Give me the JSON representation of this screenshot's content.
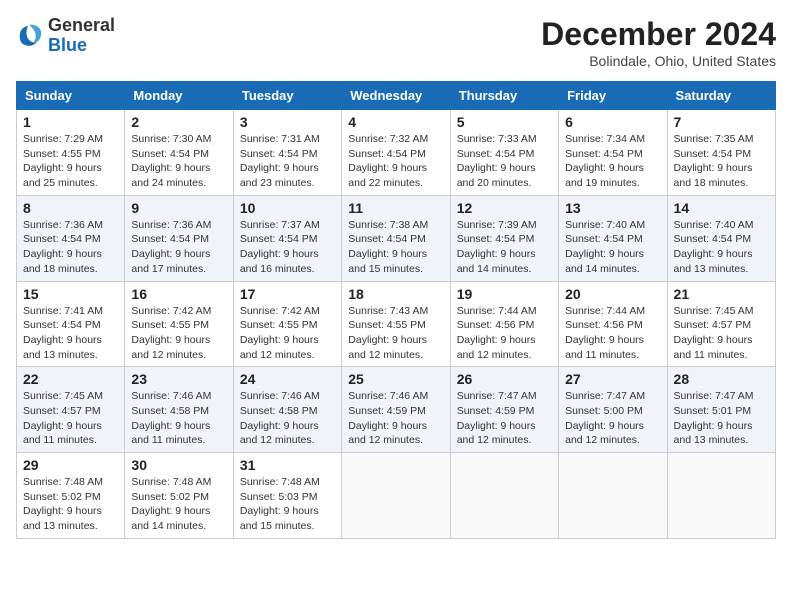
{
  "logo": {
    "line1": "General",
    "line2": "Blue"
  },
  "title": "December 2024",
  "subtitle": "Bolindale, Ohio, United States",
  "weekdays": [
    "Sunday",
    "Monday",
    "Tuesday",
    "Wednesday",
    "Thursday",
    "Friday",
    "Saturday"
  ],
  "weeks": [
    [
      {
        "day": 1,
        "sunrise": "7:29 AM",
        "sunset": "4:55 PM",
        "daylight": "9 hours and 25 minutes."
      },
      {
        "day": 2,
        "sunrise": "7:30 AM",
        "sunset": "4:54 PM",
        "daylight": "9 hours and 24 minutes."
      },
      {
        "day": 3,
        "sunrise": "7:31 AM",
        "sunset": "4:54 PM",
        "daylight": "9 hours and 23 minutes."
      },
      {
        "day": 4,
        "sunrise": "7:32 AM",
        "sunset": "4:54 PM",
        "daylight": "9 hours and 22 minutes."
      },
      {
        "day": 5,
        "sunrise": "7:33 AM",
        "sunset": "4:54 PM",
        "daylight": "9 hours and 20 minutes."
      },
      {
        "day": 6,
        "sunrise": "7:34 AM",
        "sunset": "4:54 PM",
        "daylight": "9 hours and 19 minutes."
      },
      {
        "day": 7,
        "sunrise": "7:35 AM",
        "sunset": "4:54 PM",
        "daylight": "9 hours and 18 minutes."
      }
    ],
    [
      {
        "day": 8,
        "sunrise": "7:36 AM",
        "sunset": "4:54 PM",
        "daylight": "9 hours and 18 minutes."
      },
      {
        "day": 9,
        "sunrise": "7:36 AM",
        "sunset": "4:54 PM",
        "daylight": "9 hours and 17 minutes."
      },
      {
        "day": 10,
        "sunrise": "7:37 AM",
        "sunset": "4:54 PM",
        "daylight": "9 hours and 16 minutes."
      },
      {
        "day": 11,
        "sunrise": "7:38 AM",
        "sunset": "4:54 PM",
        "daylight": "9 hours and 15 minutes."
      },
      {
        "day": 12,
        "sunrise": "7:39 AM",
        "sunset": "4:54 PM",
        "daylight": "9 hours and 14 minutes."
      },
      {
        "day": 13,
        "sunrise": "7:40 AM",
        "sunset": "4:54 PM",
        "daylight": "9 hours and 14 minutes."
      },
      {
        "day": 14,
        "sunrise": "7:40 AM",
        "sunset": "4:54 PM",
        "daylight": "9 hours and 13 minutes."
      }
    ],
    [
      {
        "day": 15,
        "sunrise": "7:41 AM",
        "sunset": "4:54 PM",
        "daylight": "9 hours and 13 minutes."
      },
      {
        "day": 16,
        "sunrise": "7:42 AM",
        "sunset": "4:55 PM",
        "daylight": "9 hours and 12 minutes."
      },
      {
        "day": 17,
        "sunrise": "7:42 AM",
        "sunset": "4:55 PM",
        "daylight": "9 hours and 12 minutes."
      },
      {
        "day": 18,
        "sunrise": "7:43 AM",
        "sunset": "4:55 PM",
        "daylight": "9 hours and 12 minutes."
      },
      {
        "day": 19,
        "sunrise": "7:44 AM",
        "sunset": "4:56 PM",
        "daylight": "9 hours and 12 minutes."
      },
      {
        "day": 20,
        "sunrise": "7:44 AM",
        "sunset": "4:56 PM",
        "daylight": "9 hours and 11 minutes."
      },
      {
        "day": 21,
        "sunrise": "7:45 AM",
        "sunset": "4:57 PM",
        "daylight": "9 hours and 11 minutes."
      }
    ],
    [
      {
        "day": 22,
        "sunrise": "7:45 AM",
        "sunset": "4:57 PM",
        "daylight": "9 hours and 11 minutes."
      },
      {
        "day": 23,
        "sunrise": "7:46 AM",
        "sunset": "4:58 PM",
        "daylight": "9 hours and 11 minutes."
      },
      {
        "day": 24,
        "sunrise": "7:46 AM",
        "sunset": "4:58 PM",
        "daylight": "9 hours and 12 minutes."
      },
      {
        "day": 25,
        "sunrise": "7:46 AM",
        "sunset": "4:59 PM",
        "daylight": "9 hours and 12 minutes."
      },
      {
        "day": 26,
        "sunrise": "7:47 AM",
        "sunset": "4:59 PM",
        "daylight": "9 hours and 12 minutes."
      },
      {
        "day": 27,
        "sunrise": "7:47 AM",
        "sunset": "5:00 PM",
        "daylight": "9 hours and 12 minutes."
      },
      {
        "day": 28,
        "sunrise": "7:47 AM",
        "sunset": "5:01 PM",
        "daylight": "9 hours and 13 minutes."
      }
    ],
    [
      {
        "day": 29,
        "sunrise": "7:48 AM",
        "sunset": "5:02 PM",
        "daylight": "9 hours and 13 minutes."
      },
      {
        "day": 30,
        "sunrise": "7:48 AM",
        "sunset": "5:02 PM",
        "daylight": "9 hours and 14 minutes."
      },
      {
        "day": 31,
        "sunrise": "7:48 AM",
        "sunset": "5:03 PM",
        "daylight": "9 hours and 15 minutes."
      },
      null,
      null,
      null,
      null
    ]
  ],
  "labels": {
    "sunrise": "Sunrise:",
    "sunset": "Sunset:",
    "daylight": "Daylight:"
  }
}
